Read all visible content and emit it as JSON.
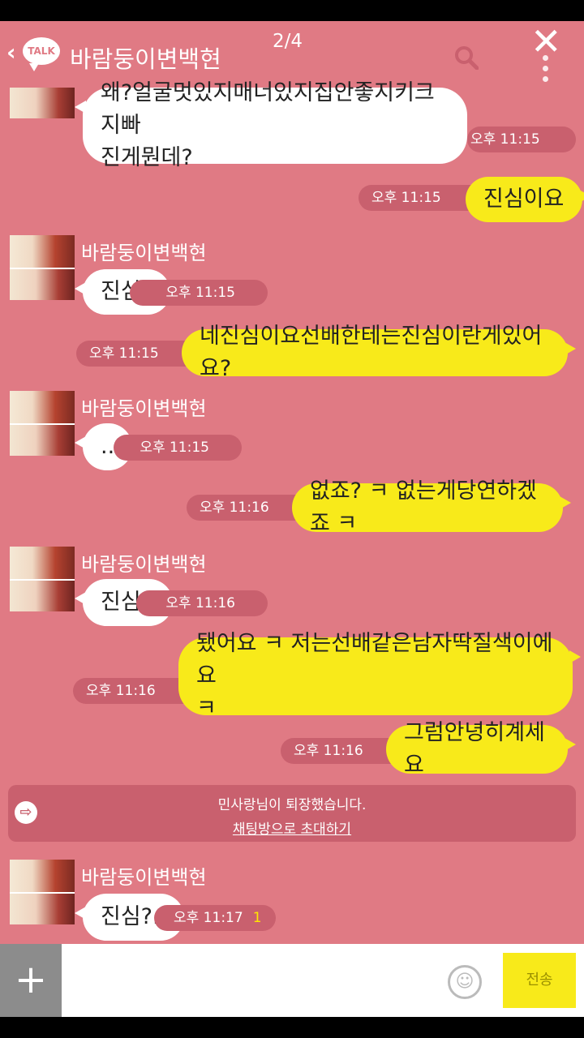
{
  "header": {
    "back": "‹",
    "talk_logo": "TALK",
    "chat_title": "바람둥이변백현",
    "page_indicator": "2/4",
    "close_icon": "✕"
  },
  "messages": [
    {
      "side": "left",
      "text_lines": [
        "왜?얼굴멋있지매너있지집안좋지키크지빠",
        "진게뭔데?"
      ],
      "time": "오후 11:15"
    },
    {
      "side": "right",
      "text": "진심이요",
      "time": "오후 11:15"
    },
    {
      "side": "left",
      "sender": "바람둥이변백현",
      "text": "진심?",
      "time": "오후 11:15"
    },
    {
      "side": "right",
      "text": "네진심이요선배한테는진심이란게있어요?",
      "time": "오후 11:15"
    },
    {
      "side": "left",
      "sender": "바람둥이변백현",
      "text": "..",
      "time": "오후 11:15"
    },
    {
      "side": "right",
      "text": "없죠? ㅋ 없는게당연하겠죠 ㅋ",
      "time": "오후 11:16"
    },
    {
      "side": "left",
      "sender": "바람둥이변백현",
      "text": "진심..",
      "time": "오후 11:16"
    },
    {
      "side": "right",
      "text_lines": [
        "됐어요 ㅋ 저는선배같은남자딱질색이에요",
        "ㅋ"
      ],
      "time": "오후 11:16"
    },
    {
      "side": "right",
      "text": "그럼안녕히계세요",
      "time": "오후 11:16"
    },
    {
      "side": "left",
      "sender": "바람둥이변백현",
      "text": "진심?..",
      "time": "오후 11:17",
      "unread": "1"
    }
  ],
  "notice": {
    "icon": "⇨",
    "text": "민사랑님이 퇴장했습니다.",
    "link": "채팅방으로 초대하기"
  },
  "input": {
    "plus": "+",
    "emoji": "☺",
    "send_label": "전송"
  },
  "colors": {
    "background": "#e07a84",
    "my_bubble": "#f8ea1a",
    "their_bubble": "#ffffff",
    "time_pill": "#c9606e"
  }
}
